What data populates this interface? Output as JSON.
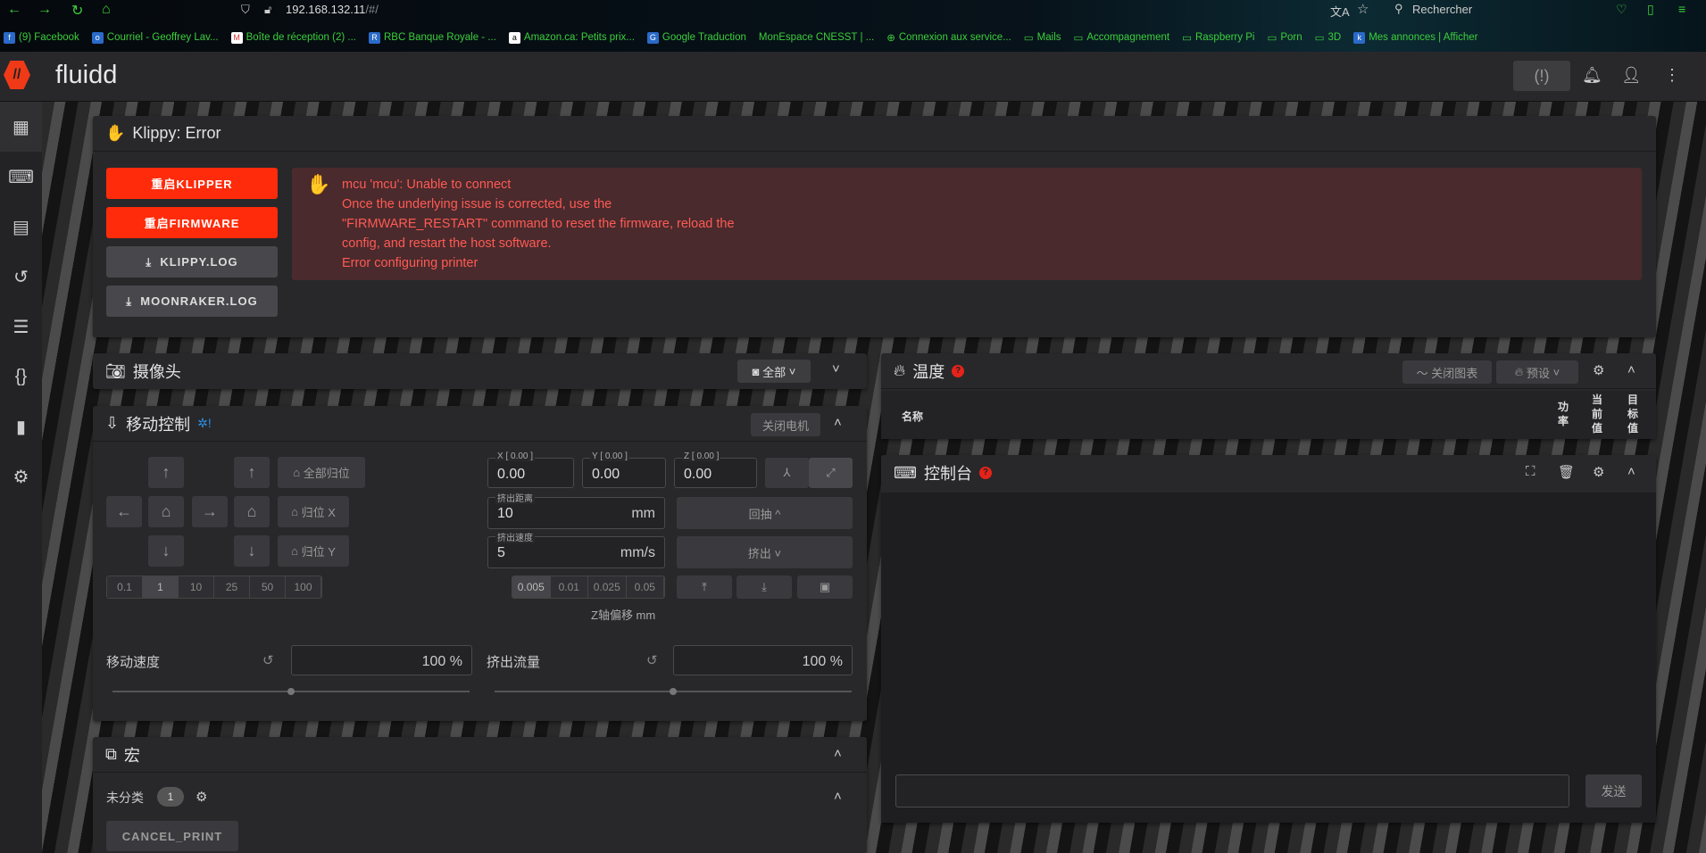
{
  "browser": {
    "url": "192.168.132.11",
    "url_suffix": "/#/",
    "search_placeholder": "Rechercher",
    "bookmarks": [
      "(9) Facebook",
      "Courriel - Geoffrey Lav...",
      "Boîte de réception (2) ...",
      "RBC Banque Royale - ...",
      "Amazon.ca: Petits prix...",
      "Google Traduction",
      "MonEspace CNESST | ...",
      "Connexion aux service...",
      "Mails",
      "Accompagnement",
      "Raspberry Pi",
      "Porn",
      "3D",
      "Mes annonces | Afficher"
    ]
  },
  "app": {
    "title": "fluidd"
  },
  "klippy": {
    "title": "Klippy: Error",
    "restart_klipper": "重启KLIPPER",
    "restart_firmware": "重启FIRMWARE",
    "klippy_log": "KLIPPY.LOG",
    "moonraker_log": "MOONRAKER.LOG",
    "error_lines": [
      "mcu 'mcu': Unable to connect",
      "Once the underlying issue is corrected, use the",
      "\"FIRMWARE_RESTART\" command to reset the firmware, reload the",
      "config, and restart the host software.",
      "Error configuring printer"
    ]
  },
  "camera": {
    "title": "摄像头",
    "filter": "全部"
  },
  "motion": {
    "title": "移动控制",
    "motors_off": "关闭电机",
    "home_all": "全部归位",
    "home_x": "归位 X",
    "home_y": "归位 Y",
    "steps": [
      "0.1",
      "1",
      "10",
      "25",
      "50",
      "100"
    ],
    "x_label": "X [ 0.00 ]",
    "x_val": "0.00",
    "y_label": "Y [ 0.00 ]",
    "y_val": "0.00",
    "z_label": "Z [ 0.00 ]",
    "z_val": "0.00",
    "extrude_len_label": "挤出距离",
    "extrude_len": "10",
    "extrude_len_unit": "mm",
    "extrude_speed_label": "挤出速度",
    "extrude_speed": "5",
    "extrude_speed_unit": "mm/s",
    "retract": "回抽 ^",
    "extrude": "挤出 ˅",
    "z_steps": [
      "0.005",
      "0.01",
      "0.025",
      "0.05"
    ],
    "z_offset_label": "Z轴偏移 mm",
    "speed_label": "移动速度",
    "speed_val": "100 %",
    "flow_label": "挤出流量",
    "flow_val": "100 %"
  },
  "macros": {
    "title": "宏",
    "group": "未分类",
    "count": "1",
    "macro": "CANCEL_PRINT"
  },
  "temperature": {
    "title": "温度",
    "hide_chart": "关闭图表",
    "presets": "预设",
    "col_name": "名称",
    "col_power": "功率",
    "col_current": "当前值",
    "col_target": "目标值"
  },
  "console": {
    "title": "控制台",
    "send": "发送"
  }
}
